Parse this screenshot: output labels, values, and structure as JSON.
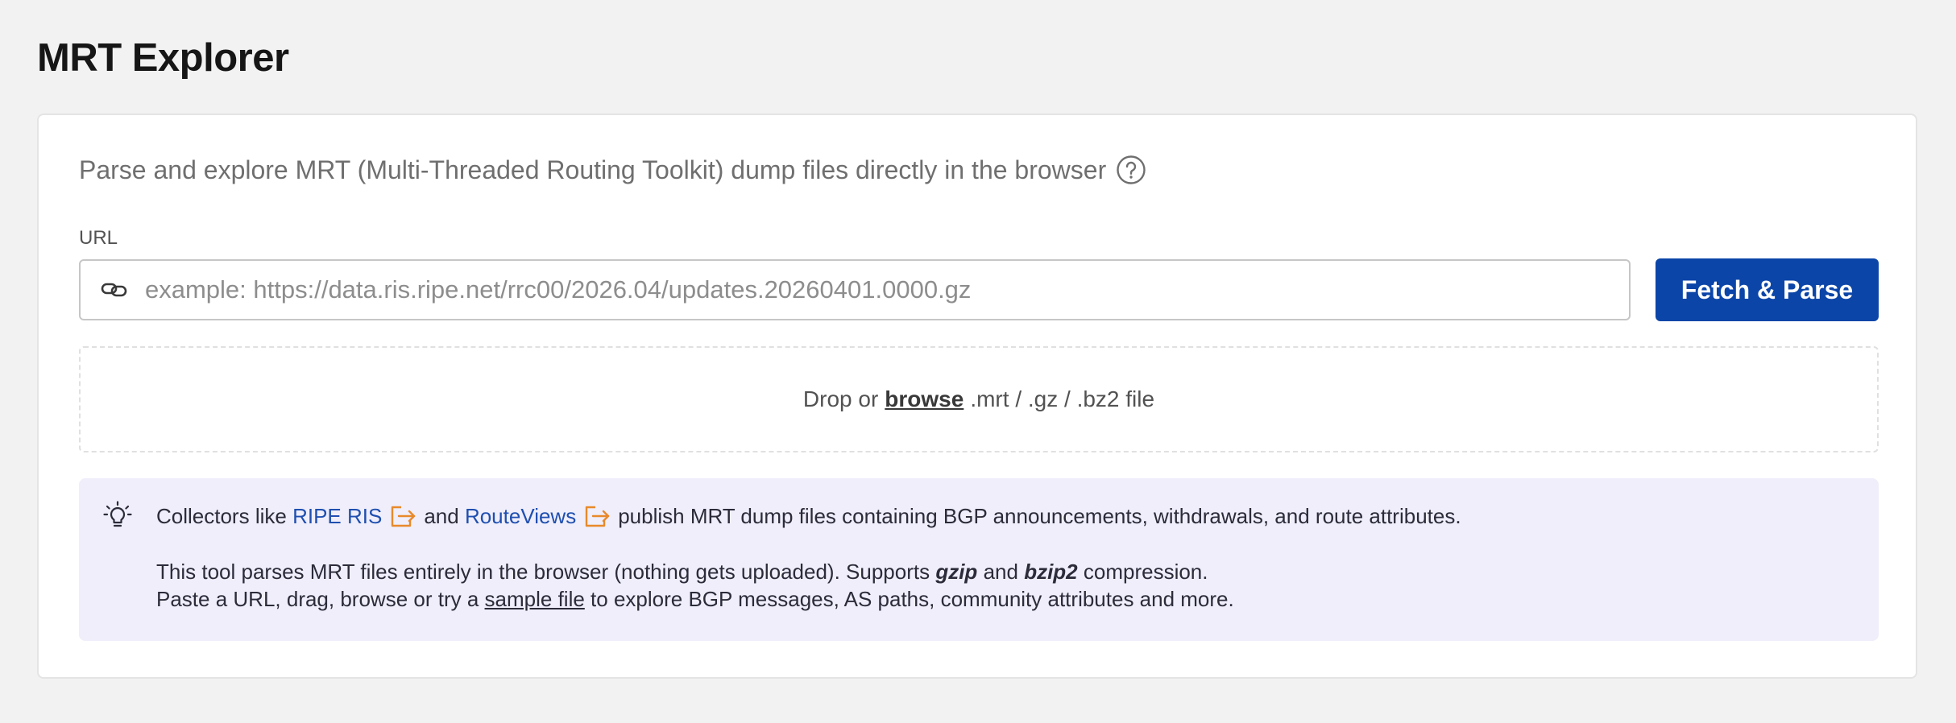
{
  "page": {
    "title": "MRT Explorer"
  },
  "main": {
    "subtitle": "Parse and explore MRT (Multi-Threaded Routing Toolkit) dump files directly in the browser",
    "url_label": "URL",
    "url_placeholder": "example: https://data.ris.ripe.net/rrc00/2026.04/updates.20260401.0000.gz",
    "url_value": "",
    "fetch_button_label": "Fetch & Parse",
    "dropzone": {
      "prefix": "Drop or",
      "browse_label": "browse",
      "suffix": ".mrt / .gz / .bz2 file"
    },
    "info": {
      "line1_prefix": "Collectors like",
      "link_ripe": "RIPE RIS",
      "line1_and": "and",
      "link_routeviews": "RouteViews",
      "line1_suffix": "publish MRT dump files containing BGP announcements, withdrawals, and route attributes.",
      "line2_prefix": "This tool parses MRT files entirely in the browser (nothing gets uploaded). Supports",
      "gzip_label": "gzip",
      "line2_and": "and",
      "bzip2_label": "bzip2",
      "line2_suffix": "compression.",
      "line3_prefix": "Paste a URL, drag, browse or try a",
      "sample_link": "sample file",
      "line3_suffix": "to explore BGP messages, AS paths, community attributes and more."
    }
  },
  "icons": {
    "help": "help-circle-icon",
    "link": "link-icon",
    "lightbulb": "lightbulb-icon",
    "external": "external-link-icon"
  },
  "colors": {
    "background": "#f2f2f2",
    "primary_button": "#0b45a8",
    "link": "#1f4fb0",
    "external_icon": "#e8892b",
    "info_background": "#efeefa"
  }
}
